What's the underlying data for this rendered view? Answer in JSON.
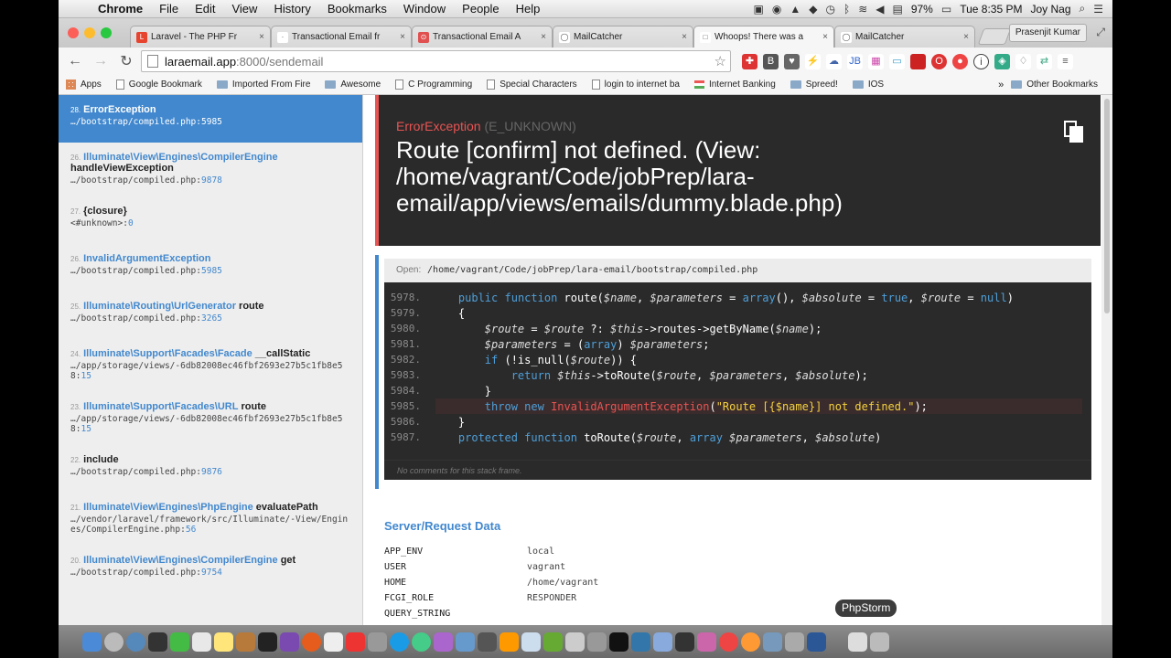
{
  "menubar": {
    "app": "Chrome",
    "items": [
      "File",
      "Edit",
      "View",
      "History",
      "Bookmarks",
      "Window",
      "People",
      "Help"
    ],
    "battery": "97%",
    "clock": "Tue 8:35 PM",
    "user": "Joy Nag"
  },
  "tabs": [
    {
      "label": "Laravel - The PHP Fr",
      "color": "#e74430",
      "glyph": "L"
    },
    {
      "label": "Transactional Email fr",
      "color": "#ffffff",
      "glyph": "·"
    },
    {
      "label": "Transactional Email A",
      "color": "#e05050",
      "glyph": "⊙"
    },
    {
      "label": "MailCatcher",
      "color": "#ffffff",
      "glyph": "◯"
    },
    {
      "label": "Whoops! There was a",
      "color": "#ffffff",
      "glyph": "□"
    },
    {
      "label": "MailCatcher",
      "color": "#ffffff",
      "glyph": "◯"
    }
  ],
  "profile": "Prasenjit Kumar",
  "address": {
    "host": "laraemail.app",
    "rest": ":8000/sendemail"
  },
  "bookmarks": [
    {
      "label": "Apps",
      "icon": "grid"
    },
    {
      "label": "Google Bookmark",
      "icon": "doc"
    },
    {
      "label": "Imported From Fire",
      "icon": "folder"
    },
    {
      "label": "Awesome",
      "icon": "folder"
    },
    {
      "label": "C Programming",
      "icon": "doc"
    },
    {
      "label": "Special Characters",
      "icon": "doc"
    },
    {
      "label": "login to internet ba",
      "icon": "doc"
    },
    {
      "label": "Internet Banking",
      "icon": "flag"
    },
    {
      "label": "Spreed!",
      "icon": "folder"
    },
    {
      "label": "IOS",
      "icon": "folder"
    }
  ],
  "bookmarks_more": "Other Bookmarks",
  "frames": [
    {
      "num": "28.",
      "cls": "ErrorException",
      "fn": "",
      "file": "…/bootstrap/compiled.php",
      "line": "5985",
      "active": true
    },
    {
      "num": "26.",
      "cls": "Illuminate\\View\\Engines\\CompilerEngine",
      "fn": "handleViewException",
      "file": "…/bootstrap/compiled.php",
      "line": "9878"
    },
    {
      "num": "27.",
      "cls": "",
      "fn": "{closure}",
      "file": "<#unknown>",
      "line": "0"
    },
    {
      "num": "26.",
      "cls": "InvalidArgumentException",
      "fn": "",
      "file": "…/bootstrap/compiled.php",
      "line": "5985"
    },
    {
      "num": "25.",
      "cls": "Illuminate\\Routing\\UrlGenerator",
      "fn": "route",
      "file": "…/bootstrap/compiled.php",
      "line": "3265"
    },
    {
      "num": "24.",
      "cls": "Illuminate\\Support\\Facades\\Facade",
      "fn": "__callStatic",
      "file": "…/app/storage/views/-6db82008ec46fbf2693e27b5c1fb8e58",
      "line": "15"
    },
    {
      "num": "23.",
      "cls": "Illuminate\\Support\\Facades\\URL",
      "fn": "route",
      "file": "…/app/storage/views/-6db82008ec46fbf2693e27b5c1fb8e58",
      "line": "15"
    },
    {
      "num": "22.",
      "cls": "",
      "fn": "include",
      "file": "…/bootstrap/compiled.php",
      "line": "9876"
    },
    {
      "num": "21.",
      "cls": "Illuminate\\View\\Engines\\PhpEngine",
      "fn": "evaluatePath",
      "file": "…/vendor/laravel/framework/src/Illuminate/-View/Engines/CompilerEngine.php",
      "line": "56"
    },
    {
      "num": "20.",
      "cls": "Illuminate\\View\\Engines\\CompilerEngine",
      "fn": "get",
      "file": "…/bootstrap/compiled.php",
      "line": "9754"
    }
  ],
  "exception": {
    "type": "ErrorException",
    "code": "(E_UNKNOWN)",
    "message": "Route [confirm] not defined. (View: /home/vagrant/Code/jobPrep/lara-email/app/views/emails/dummy.blade.php)"
  },
  "open": {
    "label": "Open:",
    "path": "/home/vagrant/Code/jobPrep/lara-email/bootstrap/compiled.php"
  },
  "code": [
    {
      "ln": "5978.",
      "indent": "    ",
      "text": "public function route($name, $parameters = array(), $absolute = true, $route = null)"
    },
    {
      "ln": "5979.",
      "indent": "    ",
      "text": "{"
    },
    {
      "ln": "5980.",
      "indent": "        ",
      "text": "$route = $route ?: $this->routes->getByName($name);"
    },
    {
      "ln": "5981.",
      "indent": "        ",
      "text": "$parameters = (array) $parameters;"
    },
    {
      "ln": "5982.",
      "indent": "        ",
      "text": "if (!is_null($route)) {"
    },
    {
      "ln": "5983.",
      "indent": "            ",
      "text": "return $this->toRoute($route, $parameters, $absolute);"
    },
    {
      "ln": "5984.",
      "indent": "        ",
      "text": "}"
    },
    {
      "ln": "5985.",
      "indent": "        ",
      "text": "throw new InvalidArgumentException(\"Route [{$name}] not defined.\");",
      "highlight": true
    },
    {
      "ln": "5986.",
      "indent": "    ",
      "text": "}"
    },
    {
      "ln": "5987.",
      "indent": "    ",
      "text": "protected function toRoute($route, array $parameters, $absolute)"
    }
  ],
  "no_comments": "No comments for this stack frame.",
  "server": {
    "title": "Server/Request Data",
    "rows": [
      {
        "k": "APP_ENV",
        "v": "local"
      },
      {
        "k": "USER",
        "v": "vagrant"
      },
      {
        "k": "HOME",
        "v": "/home/vagrant"
      },
      {
        "k": "FCGI_ROLE",
        "v": "RESPONDER"
      },
      {
        "k": "QUERY_STRING",
        "v": ""
      }
    ]
  },
  "tooltip": "PhpStorm",
  "colors": {
    "accent": "#4288ce",
    "error": "#e95353",
    "header_bg": "#2a2a2a"
  }
}
